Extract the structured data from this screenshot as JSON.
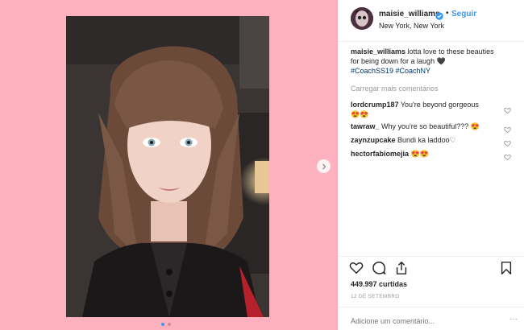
{
  "post": {
    "username": "maisie_williams",
    "follow_label": "Seguir",
    "separator": "•",
    "location": "New York, New York",
    "caption_user": "maisie_williams",
    "caption_text_1": " lotta love to these beauties",
    "caption_text_2": "for being down for a laugh 🖤",
    "hashtags": "#CoachSS19 #CoachNY",
    "load_more": "Carregar mais comentários",
    "comments": [
      {
        "user": "lordcrump187",
        "text": " You're beyond gorgeous"
      },
      {
        "user": "tawraw_",
        "text": " Why you're so beautiful???"
      },
      {
        "user": "zaynzupcake",
        "text": " Bundi ka laddoo♡"
      },
      {
        "user": "hectorfabiomejia",
        "text": ""
      }
    ],
    "emoji_1": "😍😍",
    "emoji_2": "😍",
    "emoji_4": "😍😍",
    "likes": "449.997 curtidas",
    "date": "12 DE SETEMBRO",
    "add_comment_placeholder": "Adicione um comentário...",
    "more": "···"
  },
  "colors": {
    "background_pink": "#fdb0bd",
    "link_blue": "#3897f0",
    "hashtag_blue": "#003569"
  },
  "icons": {
    "like": "heart-outline-icon",
    "comment": "speech-bubble-icon",
    "share": "share-icon",
    "save": "bookmark-icon",
    "next": "chevron-right-icon",
    "verified": "verified-badge-icon"
  }
}
